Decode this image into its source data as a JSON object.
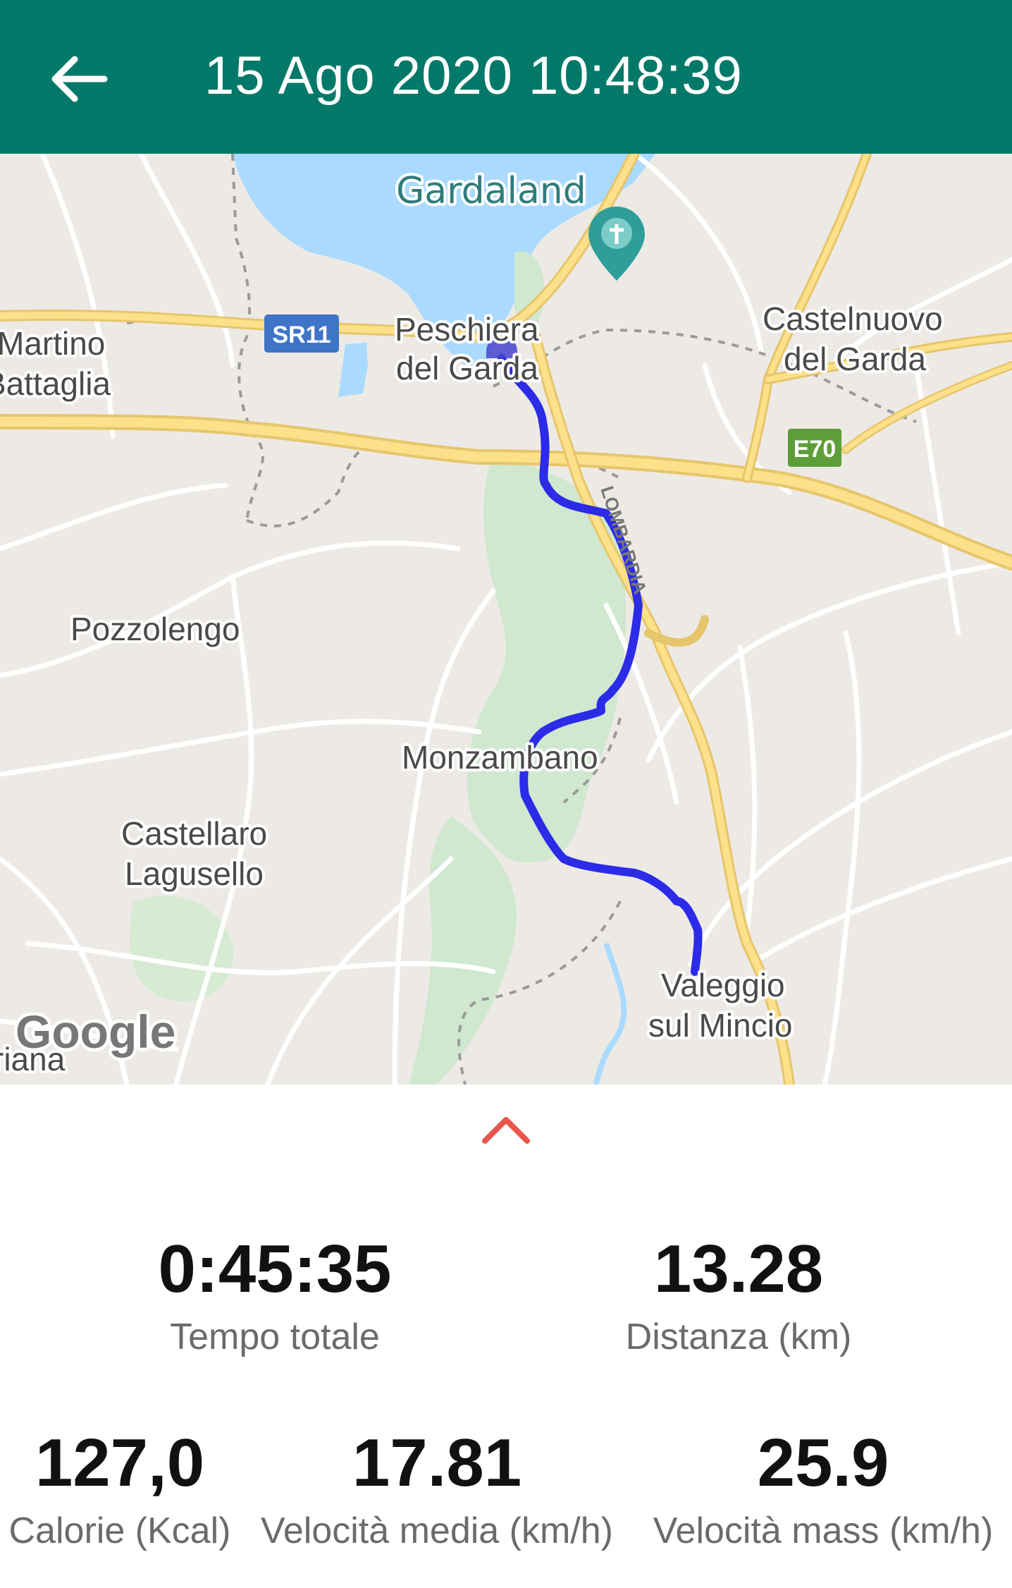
{
  "header": {
    "title": "15 Ago 2020 10:48:39",
    "back_icon": "arrow-left-icon",
    "background": "#04796A"
  },
  "map": {
    "labels": {
      "gardaland": "Gardaland",
      "peschiera_1": "Peschiera",
      "peschiera_2": "del Garda",
      "castelnuovo_1": "Castelnuovo",
      "castelnuovo_2": "del Garda",
      "martino_1": "Martino",
      "martino_2": "Battaglia",
      "pozzolengo": "Pozzolengo",
      "monzambano": "Monzambano",
      "castellaro_1": "Castellaro",
      "castellaro_2": "Lagusello",
      "valeggio_1": "Valeggio",
      "valeggio_2": "sul Mincio",
      "volta": "riana",
      "lombardia": "LOMBARDIA"
    },
    "shields": {
      "sr11": "SR11",
      "e70": "E70"
    },
    "attribution": "Google",
    "route_color": "#2B2BE8"
  },
  "sheet": {
    "expand_icon": "chevron-up-icon",
    "accent": "#E8574B"
  },
  "stats": {
    "total_time": {
      "value": "0:45:35",
      "label": "Tempo totale"
    },
    "distance": {
      "value": "13.28",
      "label": "Distanza (km)"
    },
    "calories": {
      "value": "127,0",
      "label": "Calorie (Kcal)"
    },
    "avg_speed": {
      "value": "17.81",
      "label": "Velocità media (km/h)"
    },
    "max_speed": {
      "value": "25.9",
      "label": "Velocità mass (km/h)"
    }
  }
}
